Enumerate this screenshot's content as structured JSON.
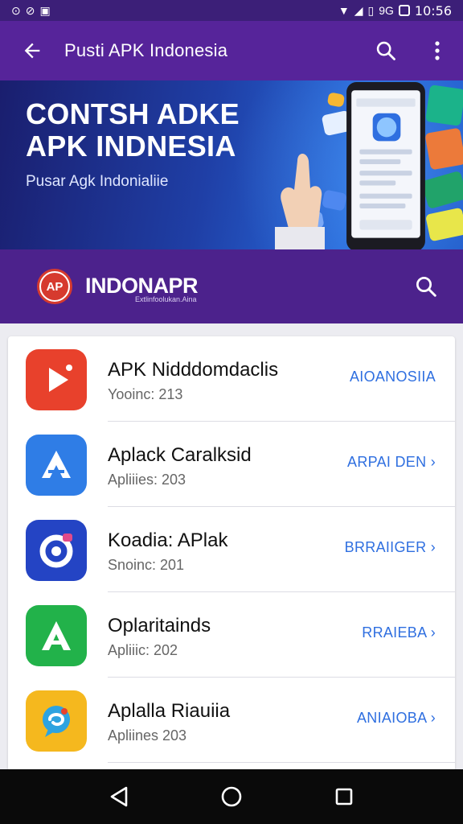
{
  "status_bar": {
    "time": "10:56",
    "signal_text": "9G"
  },
  "toolbar": {
    "title": "Pusti APK Indonesia",
    "icons": [
      "back-arrow-icon",
      "search-icon",
      "more-vert-icon"
    ]
  },
  "banner": {
    "headline_line1": "CONTSH ADKE",
    "headline_line2": "APK INDNESIA",
    "subtitle": "Pusar Agk Indonialiie"
  },
  "brand": {
    "logo_text": "AP",
    "name": "INDONAPR",
    "tagline": "Extlinfoolukan.Aina"
  },
  "apps": [
    {
      "name": "APK Nidddomdaclis",
      "meta": "Yooinc: 213",
      "action": "AIOANOSIIA",
      "icon": "play-icon",
      "color": "#e8412c"
    },
    {
      "name": "Aplack Caralksid",
      "meta": "Apliiies: 203",
      "action": "ARPAI DEN ›",
      "icon": "a-triangle-icon",
      "color": "#2f7de6"
    },
    {
      "name": "Koadia: APlak",
      "meta": "Snoinc: 201",
      "action": "BRRAIIGER ›",
      "icon": "ring-icon",
      "color": "#2444c4"
    },
    {
      "name": "Oplaritainds",
      "meta": "Apliiic: 202",
      "action": "RRAIEBA ›",
      "icon": "a-letter-icon",
      "color": "#22b24a"
    },
    {
      "name": "Aplalla Riauiia",
      "meta": "Apliines 203",
      "action": "ANIAIOBA ›",
      "icon": "chat-bubble-icon",
      "color": "#f5b81e"
    }
  ],
  "nav": {
    "icons": [
      "back-triangle-icon",
      "home-circle-icon",
      "recents-square-icon"
    ]
  }
}
